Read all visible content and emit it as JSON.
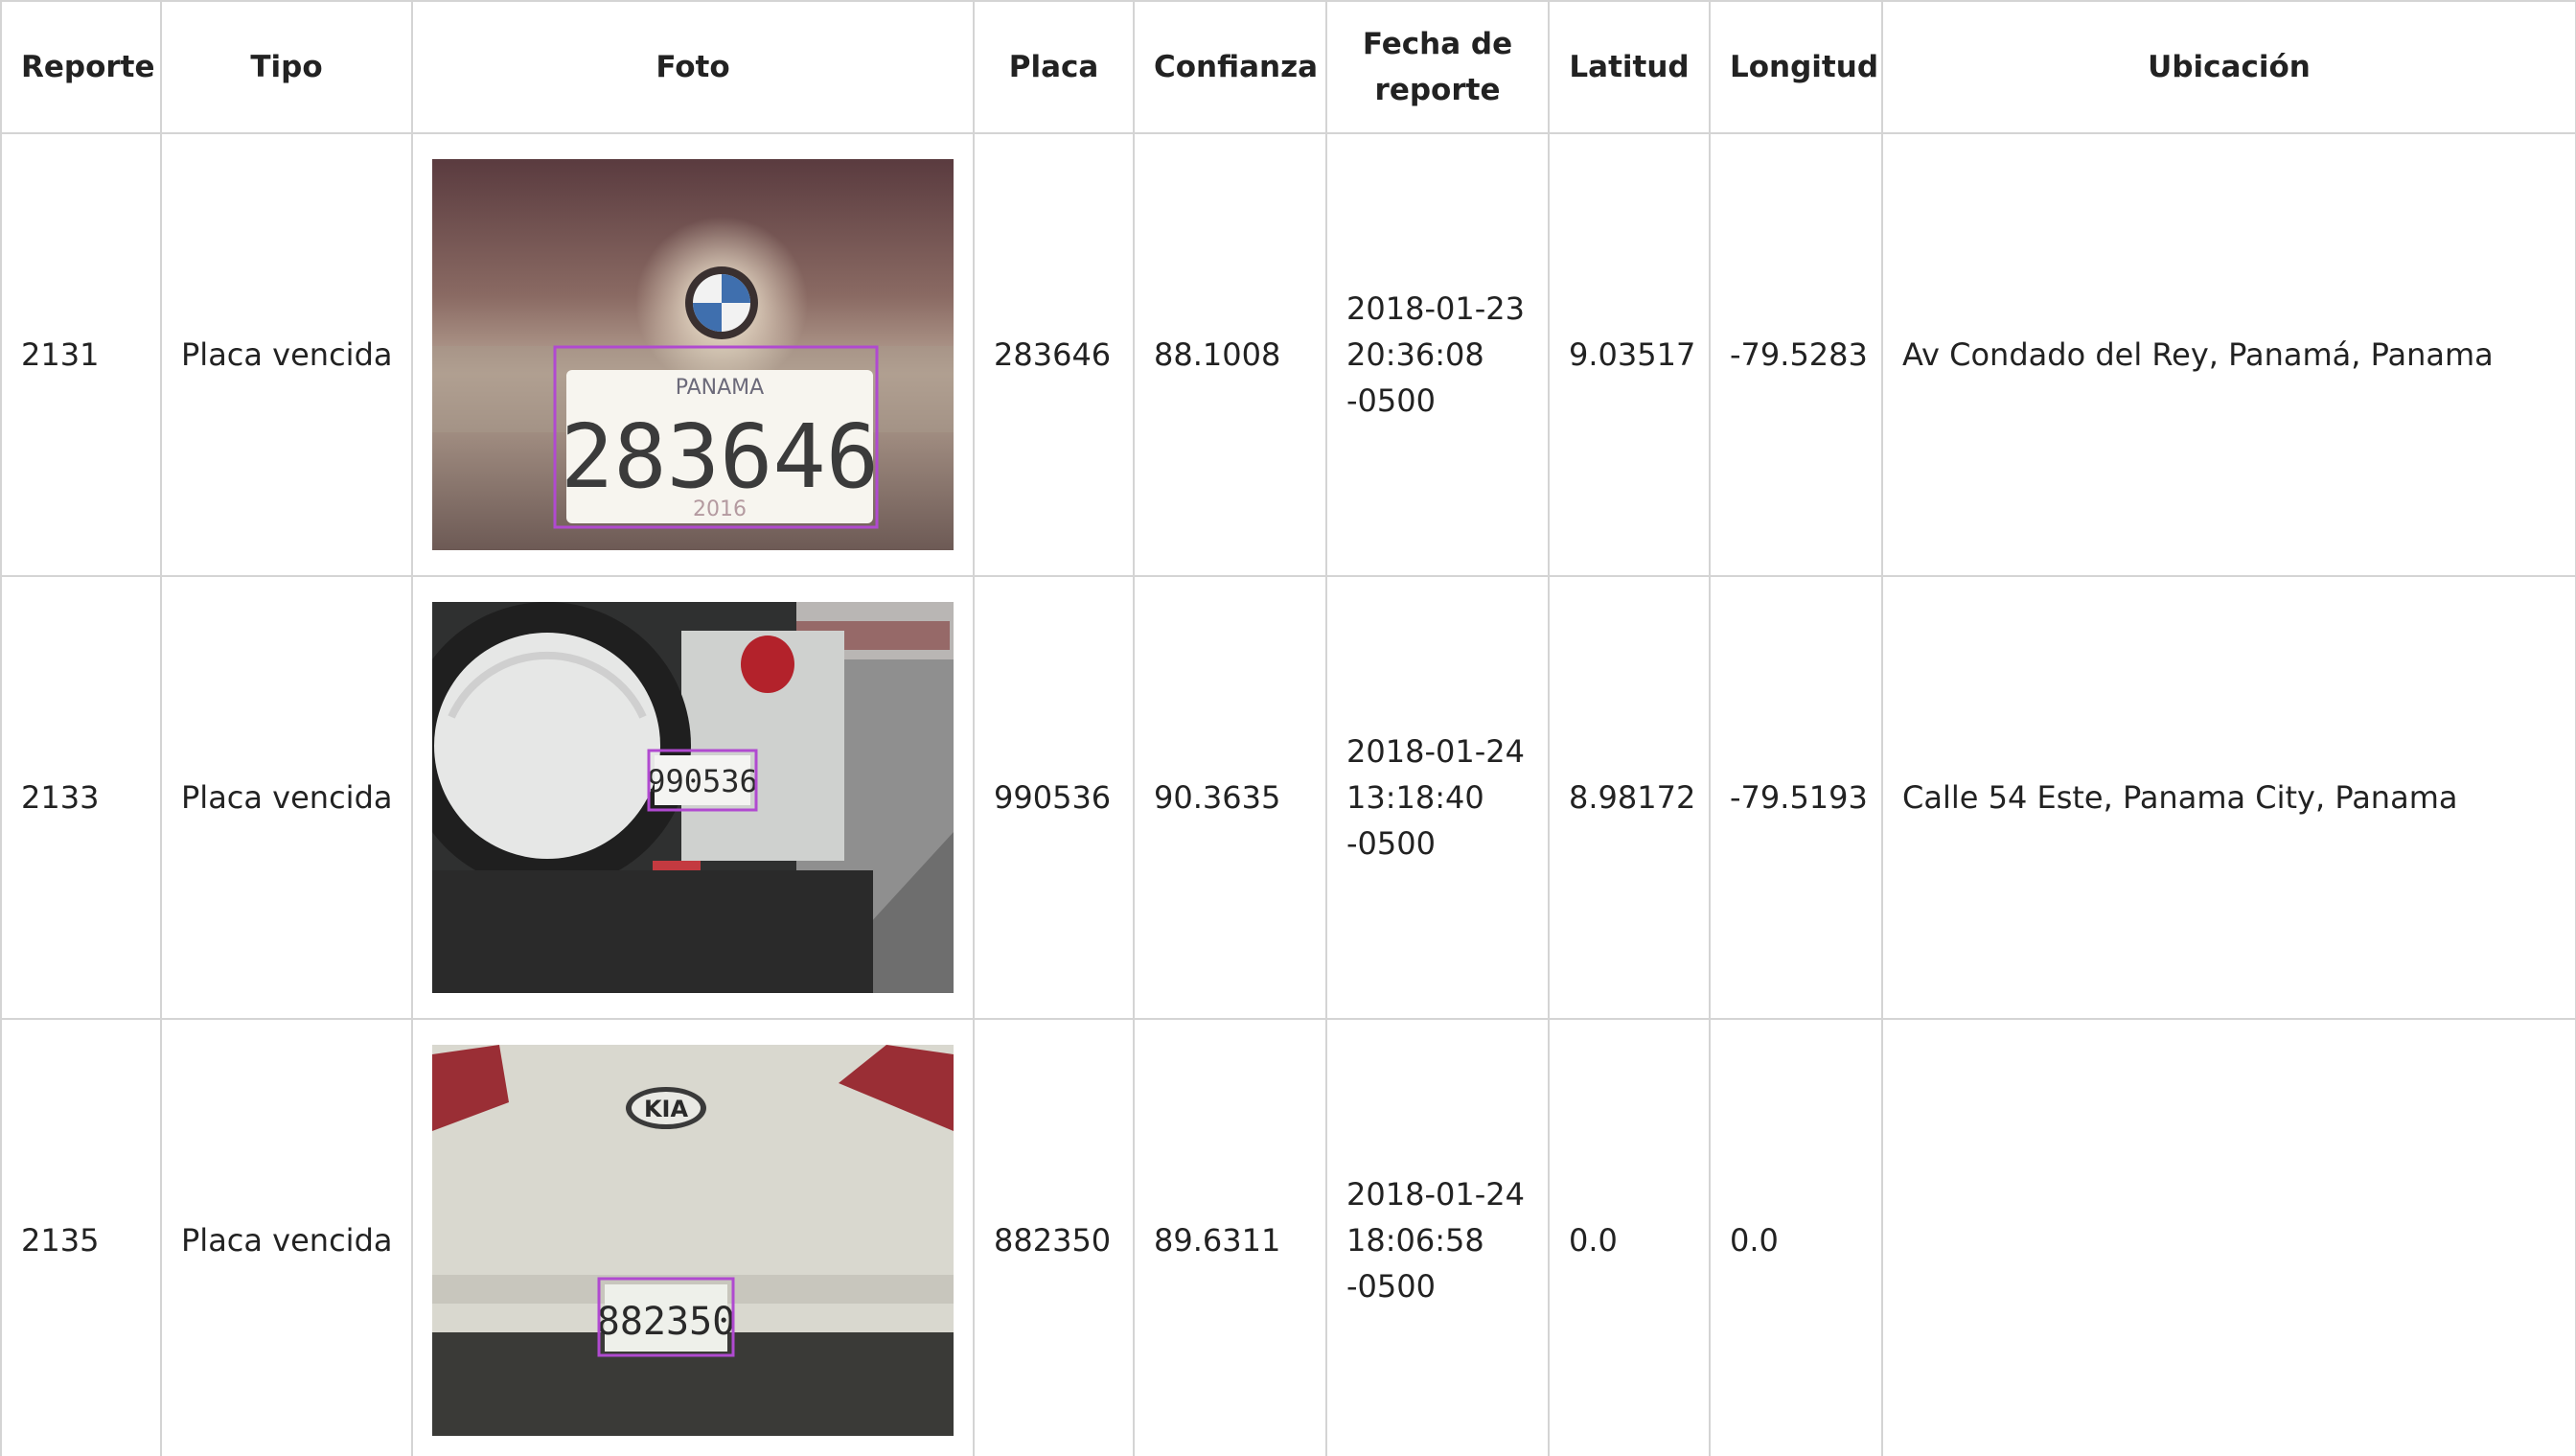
{
  "table": {
    "headers": {
      "reporte": "Reporte",
      "tipo": "Tipo",
      "foto": "Foto",
      "placa": "Placa",
      "confianza": "Confianza",
      "fecha_line1": "Fecha de",
      "fecha_line2": "reporte",
      "latitud": "Latitud",
      "longitud": "Longitud",
      "ubicacion": "Ubicación"
    },
    "rows": [
      {
        "reporte": "2131",
        "tipo": "Placa vencida",
        "foto": {
          "plate_text": "283646",
          "plate_top_text": "PANAMA",
          "plate_year": "2016",
          "car_brand": "BMW"
        },
        "placa": "283646",
        "confianza": "88.1008",
        "fecha": [
          "2018-01-23",
          "20:36:08",
          "-0500"
        ],
        "latitud": "9.03517",
        "longitud": "-79.5283",
        "ubicacion": "Av Condado del Rey, Panamá, Panama"
      },
      {
        "reporte": "2133",
        "tipo": "Placa vencida",
        "foto": {
          "plate_text": "990536"
        },
        "placa": "990536",
        "confianza": "90.3635",
        "fecha": [
          "2018-01-24",
          "13:18:40",
          "-0500"
        ],
        "latitud": "8.98172",
        "longitud": "-79.5193",
        "ubicacion": "Calle 54 Este, Panama City, Panama"
      },
      {
        "reporte": "2135",
        "tipo": "Placa vencida",
        "foto": {
          "plate_text": "882350",
          "car_brand": "KIA"
        },
        "placa": "882350",
        "confianza": "89.6311",
        "fecha": [
          "2018-01-24",
          "18:06:58",
          "-0500"
        ],
        "latitud": "0.0",
        "longitud": "0.0",
        "ubicacion": ""
      }
    ]
  },
  "colors": {
    "border": "#d4d4d4",
    "text": "#222222",
    "detection_box": "#b04ad0"
  }
}
